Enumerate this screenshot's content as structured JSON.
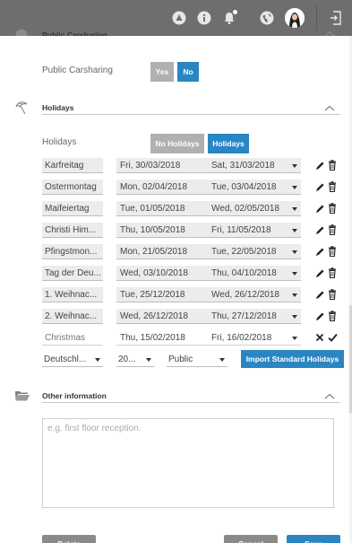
{
  "topbar": {
    "icons": [
      "warning-triangle-icon",
      "info-icon",
      "bell-icon",
      "globe-icon",
      "avatar",
      "logout-icon"
    ]
  },
  "carsharing": {
    "section_title": "Public Carsharing",
    "label": "Public Carsharing",
    "yes_label": "Yes",
    "no_label": "No",
    "selected": "No"
  },
  "holidays": {
    "section_title": "Holidays",
    "label": "Holidays",
    "no_holidays_label": "No Holidays",
    "holidays_label": "Holidays",
    "selected": "Holidays",
    "rows": [
      {
        "name": "Karfreitag",
        "start": "Fri, 30/03/2018",
        "end": "Sat, 31/03/2018"
      },
      {
        "name": "Ostermontag",
        "start": "Mon, 02/04/2018",
        "end": "Tue, 03/04/2018"
      },
      {
        "name": "Maifeiertag",
        "start": "Tue, 01/05/2018",
        "end": "Wed, 02/05/2018"
      },
      {
        "name": "Christi Him...",
        "start": "Thu, 10/05/2018",
        "end": "Fri, 11/05/2018"
      },
      {
        "name": "Pfingstmon...",
        "start": "Mon, 21/05/2018",
        "end": "Tue, 22/05/2018"
      },
      {
        "name": "Tag der Deu...",
        "start": "Wed, 03/10/2018",
        "end": "Thu, 04/10/2018"
      },
      {
        "name": "1. Weihnac...",
        "start": "Tue, 25/12/2018",
        "end": "Wed, 26/12/2018"
      },
      {
        "name": "2. Weihnac...",
        "start": "Wed, 26/12/2018",
        "end": "Thu, 27/12/2018"
      }
    ],
    "new_row": {
      "name_placeholder": "Christmas",
      "start": "Thu, 15/02/2018",
      "end": "Fri, 16/02/2018"
    },
    "country_select": "Deutschl...",
    "year_select": "20...",
    "type_select": "Public",
    "import_label": "Import Standard Holidays"
  },
  "other": {
    "section_title": "Other information",
    "notes_placeholder": "e.g. first floor reception."
  },
  "footer": {
    "delete_label": "Delete",
    "cancel_label": "Cancel",
    "save_label": "Save"
  },
  "colors": {
    "topbar": "#6e6e6e",
    "accent_blue": "#2a86c3",
    "button_grey": "#b0b0b0"
  }
}
